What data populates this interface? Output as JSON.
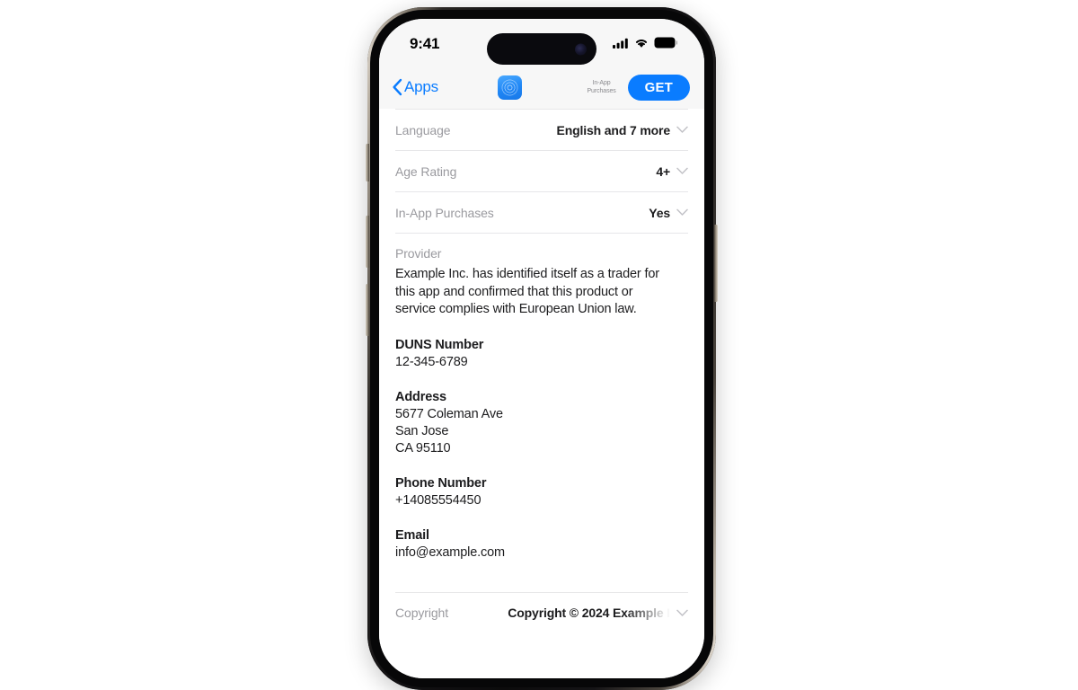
{
  "status_bar": {
    "time": "9:41",
    "icons": [
      "cellular-signal-icon",
      "wifi-icon",
      "battery-icon"
    ]
  },
  "nav_bar": {
    "back_label": "Apps",
    "back_icon": "chevron-left-icon",
    "app_icon": "app-icon",
    "in_app_purchases_label": "In-App Purchases",
    "get_label": "GET"
  },
  "info_rows": [
    {
      "label": "Language",
      "value": "English and 7 more",
      "disclosure": "chevron-down-icon"
    },
    {
      "label": "Age Rating",
      "value": "4+",
      "disclosure": "chevron-down-icon"
    },
    {
      "label": "In-App Purchases",
      "value": "Yes",
      "disclosure": "chevron-down-icon"
    }
  ],
  "provider": {
    "heading": "Provider",
    "statement": "Example Inc. has identified itself as a trader for this app and confirmed that this product or service complies with European Union law.",
    "fields": [
      {
        "label": "DUNS Number",
        "lines": [
          "12-345-6789"
        ]
      },
      {
        "label": "Address",
        "lines": [
          "5677 Coleman Ave",
          "San Jose",
          "CA 95110"
        ]
      },
      {
        "label": "Phone Number",
        "lines": [
          "+14085554450"
        ]
      },
      {
        "label": "Email",
        "lines": [
          "info@example.com"
        ]
      }
    ]
  },
  "copyright_row": {
    "label": "Copyright",
    "value": "Copyright © 2024 Example I",
    "disclosure": "chevron-down-icon"
  },
  "colors": {
    "accent_blue": "#0a7cff",
    "label_gray": "#9a9a9f",
    "text_black": "#1c1c1e",
    "divider": "#e7e7e9",
    "chrome_bg": "#f7f7f7",
    "page_bg": "#ffffff"
  }
}
